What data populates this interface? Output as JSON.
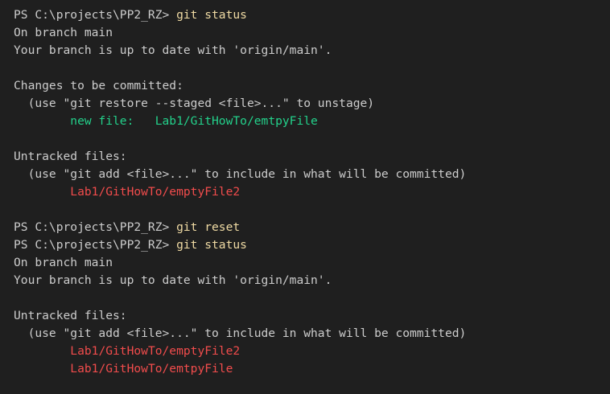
{
  "colors": {
    "background": "#1f1f1f",
    "text": "#cccccc",
    "command": "#f0dba4",
    "staged": "#23d18b",
    "untracked": "#f14c4c"
  },
  "terminal": {
    "prompt": "PS C:\\projects\\PP2_RZ> ",
    "cmd_status": "git status",
    "cmd_reset": "git reset",
    "branch": "On branch main",
    "up_to_date": "Your branch is up to date with 'origin/main'.",
    "changes_header": "Changes to be committed:",
    "restore_hint": "  (use \"git restore --staged <file>...\" to unstage)",
    "new_file_label": "        new file:   ",
    "staged_file": "Lab1/GitHowTo/emtpyFile",
    "untracked_header": "Untracked files:",
    "add_hint": "  (use \"git add <file>...\" to include in what will be committed)",
    "indent": "        ",
    "untracked_file_1": "Lab1/GitHowTo/emptyFile2",
    "untracked_file_2": "Lab1/GitHowTo/emtpyFile"
  }
}
